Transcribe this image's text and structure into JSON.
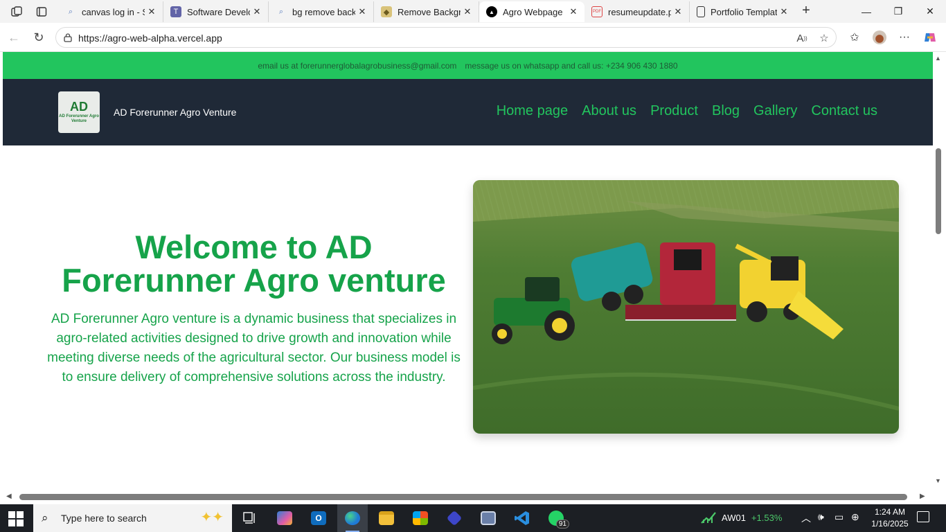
{
  "browser": {
    "tabs": [
      {
        "label": "canvas log in - Se",
        "icon": "search-icon",
        "active": false
      },
      {
        "label": "Software Develop",
        "icon": "teams-icon",
        "active": false
      },
      {
        "label": "bg remove backg",
        "icon": "search-icon",
        "active": false
      },
      {
        "label": "Remove Backgro",
        "icon": "layers-icon",
        "active": false
      },
      {
        "label": "Agro Webpage",
        "icon": "vercel-icon",
        "active": true
      },
      {
        "label": "resumeupdate.p",
        "icon": "pdf-icon",
        "active": false
      },
      {
        "label": "Portfolio Templat",
        "icon": "document-icon",
        "active": false
      }
    ],
    "url": "https://agro-web-alpha.vercel.app"
  },
  "site": {
    "topbar": {
      "email": "email us at forerunnerglobalagrobusiness@gmail.com",
      "phone": "message us on whatsapp and call us: +234 906 430 1880"
    },
    "logo": {
      "mark": "AD",
      "text": "AD Forerunner Agro Venture"
    },
    "brand": "AD Forerunner Agro Venture",
    "nav": [
      "Home page",
      "About us",
      "Product",
      "Blog",
      "Gallery",
      "Contact us"
    ],
    "hero": {
      "title_line1": "Welcome to AD",
      "title_line2": "Forerunner Agro venture",
      "description": "AD Forerunner Agro venture is a dynamic business that specializes in agro-related activities designed to drive growth and innovation while meeting diverse needs of the agricultural sector. Our business model is to ensure delivery of comprehensive solutions across the industry."
    },
    "colors": {
      "accent": "#22c55e",
      "header_bg": "#1f2937",
      "hero_text": "#16a34a"
    }
  },
  "taskbar": {
    "search_placeholder": "Type here to search",
    "whatsapp_badge": "91",
    "stock": {
      "symbol": "AW01",
      "change": "+1.53%"
    },
    "time": "1:24 AM",
    "date": "1/16/2025"
  }
}
